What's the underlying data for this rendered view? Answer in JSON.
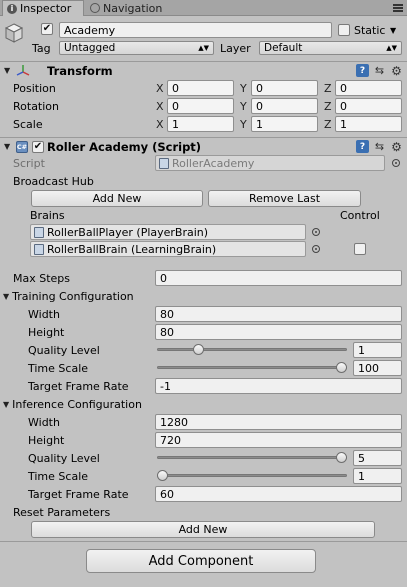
{
  "tabs": [
    {
      "label": "Inspector",
      "icon": "info-icon",
      "active": true
    },
    {
      "label": "Navigation",
      "icon": "compass-icon",
      "active": false
    }
  ],
  "object": {
    "active": true,
    "name": "Academy",
    "static_label": "Static",
    "static_checked": false,
    "tag_label": "Tag",
    "tag_value": "Untagged",
    "layer_label": "Layer",
    "layer_value": "Default"
  },
  "transform": {
    "title": "Transform",
    "rows": [
      {
        "label": "Position",
        "x": "0",
        "y": "0",
        "z": "0"
      },
      {
        "label": "Rotation",
        "x": "0",
        "y": "0",
        "z": "0"
      },
      {
        "label": "Scale",
        "x": "1",
        "y": "1",
        "z": "1"
      }
    ],
    "axis": {
      "x": "X",
      "y": "Y",
      "z": "Z"
    }
  },
  "script_component": {
    "title": "Roller Academy (Script)",
    "enabled": true,
    "script_label": "Script",
    "script_value": "RollerAcademy",
    "broadcast_hub_label": "Broadcast Hub",
    "add_new_label": "Add New",
    "remove_last_label": "Remove Last",
    "brains_label": "Brains",
    "control_label": "Control",
    "brains": [
      {
        "name": "RollerBallPlayer (PlayerBrain)",
        "has_control": false
      },
      {
        "name": "RollerBallBrain (LearningBrain)",
        "has_control": true,
        "control_checked": false
      }
    ],
    "max_steps_label": "Max Steps",
    "max_steps": "0",
    "training": {
      "label": "Training Configuration",
      "width_label": "Width",
      "width": "80",
      "height_label": "Height",
      "height": "80",
      "quality_label": "Quality Level",
      "quality": "1",
      "quality_fraction": 0.2,
      "timescale_label": "Time Scale",
      "timescale": "100",
      "timescale_fraction": 1.0,
      "framerate_label": "Target Frame Rate",
      "framerate": "-1"
    },
    "inference": {
      "label": "Inference Configuration",
      "width_label": "Width",
      "width": "1280",
      "height_label": "Height",
      "height": "720",
      "quality_label": "Quality Level",
      "quality": "5",
      "quality_fraction": 1.0,
      "timescale_label": "Time Scale",
      "timescale": "1",
      "timescale_fraction": 0.0,
      "framerate_label": "Target Frame Rate",
      "framerate": "60"
    },
    "reset_params_label": "Reset Parameters",
    "reset_add_new_label": "Add New"
  },
  "add_component_label": "Add Component"
}
